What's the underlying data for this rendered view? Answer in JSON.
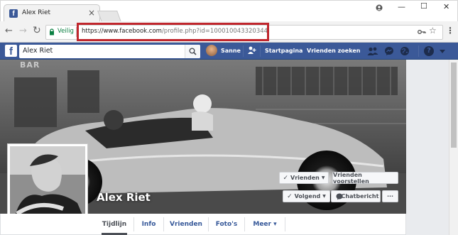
{
  "browser": {
    "tab_title": "Alex Riet",
    "tab_close": "×",
    "secure_label": "Veilig",
    "url_scheme_host": "https://www.facebook.com",
    "url_path": "/profile.php?id=100010043320344",
    "controls": {
      "minimize": "—",
      "maximize": "☐",
      "close": "✕"
    }
  },
  "fb": {
    "search_value": "Alex Riet",
    "user_name": "Sanne",
    "home_label": "Startpagina",
    "find_friends_label": "Vrienden zoeken",
    "brand_color": "#3b5998"
  },
  "profile": {
    "name": "Alex Riet",
    "friends_button": "Vrienden",
    "suggest_friends_button": "Vrienden voorstellen",
    "follow_button": "Volgend",
    "message_button": "Chatbericht",
    "more_button": "···",
    "cover_sign": "BAR"
  },
  "timeline_tabs": [
    {
      "label": "Tijdlijn",
      "active": true
    },
    {
      "label": "Info"
    },
    {
      "label": "Vrienden"
    },
    {
      "label": "Foto's"
    },
    {
      "label": "Meer ▾"
    }
  ]
}
